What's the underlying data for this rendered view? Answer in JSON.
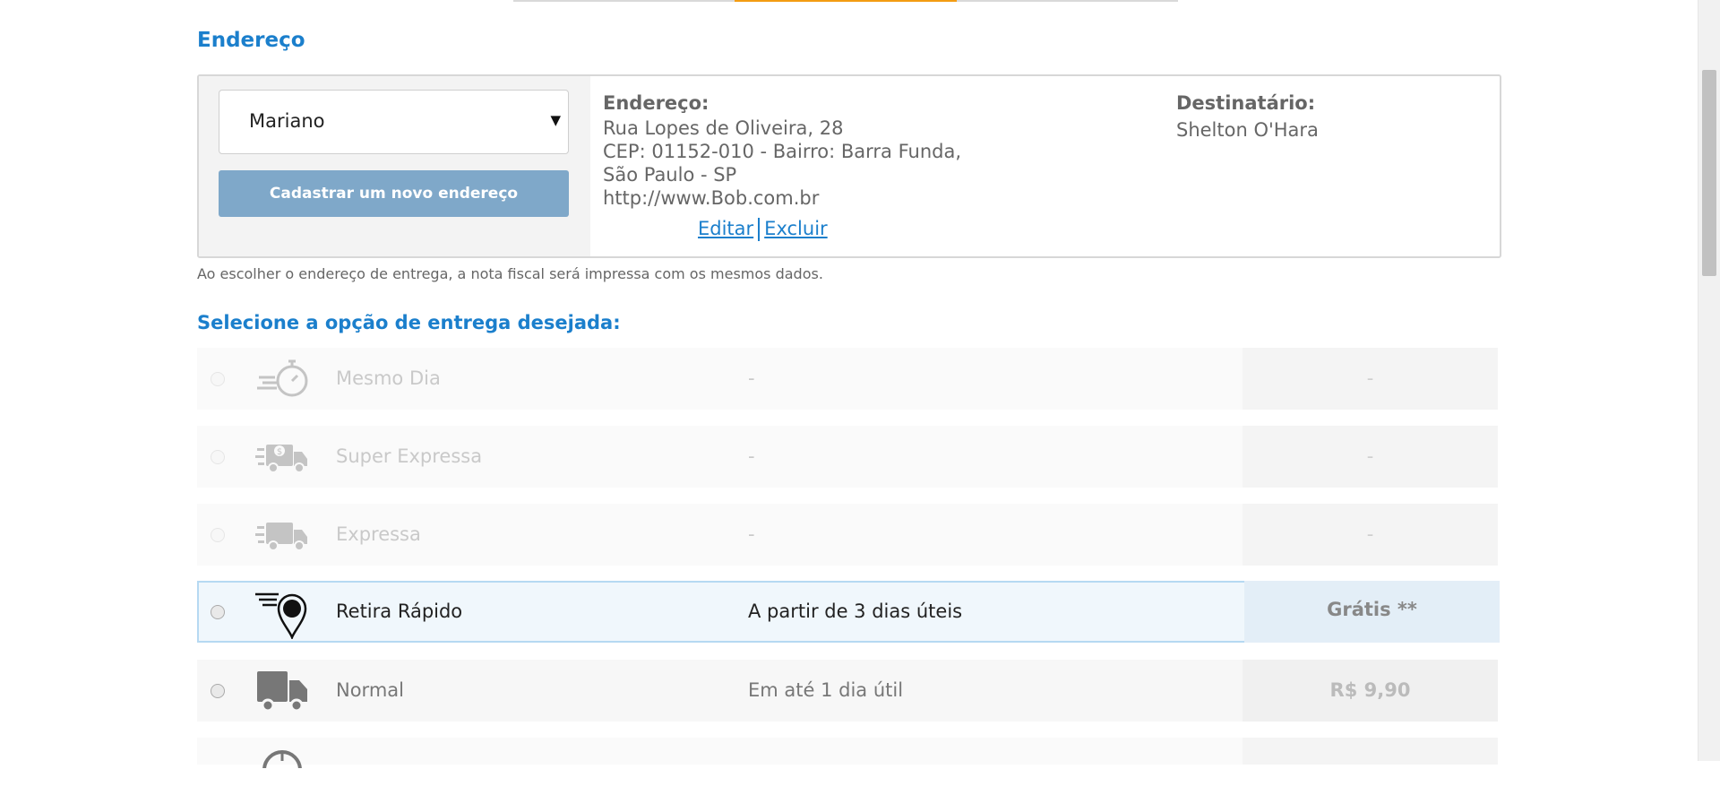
{
  "address_section": {
    "title": "Endereço",
    "selected_address": "Mariano",
    "new_address_button": "Cadastrar um novo endereço",
    "address_label": "Endereço:",
    "address_lines": [
      "Rua Lopes de Oliveira, 28",
      "CEP: 01152-010 - Bairro: Barra Funda,",
      "São Paulo - SP",
      "http://www.Bob.com.br"
    ],
    "edit_link": "Editar",
    "delete_link": "Excluir",
    "recipient_label": "Destinatário:",
    "recipient_name": "Shelton O'Hara",
    "note": "Ao escolher o endereço de entrega, a nota fiscal será impressa com os mesmos dados."
  },
  "shipping": {
    "title": "Selecione a opção de entrega desejada:",
    "options": [
      {
        "name": "Mesmo Dia",
        "time": "-",
        "price": "-",
        "icon": "stopwatch-icon",
        "enabled": false
      },
      {
        "name": "Super Expressa",
        "time": "-",
        "price": "-",
        "icon": "express-money-truck-icon",
        "enabled": false
      },
      {
        "name": "Expressa",
        "time": "-",
        "price": "-",
        "icon": "fast-truck-icon",
        "enabled": false
      },
      {
        "name": "Retira Rápido",
        "time": "A partir de 3 dias úteis",
        "price": "Grátis **",
        "icon": "pickup-location-pin-icon",
        "enabled": true,
        "highlighted": true
      },
      {
        "name": "Normal",
        "time": "Em até 1 dia útil",
        "price": "R$ 9,90",
        "icon": "truck-icon",
        "enabled": true
      }
    ]
  },
  "colors": {
    "accent": "#1b7fcc",
    "button": "#7fa8c9",
    "progress": "#f39c12"
  }
}
